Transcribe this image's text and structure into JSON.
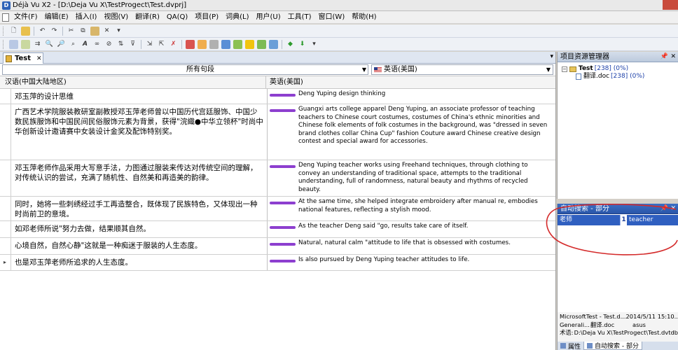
{
  "window": {
    "title": "Déjà Vu X2 - [D:\\Deja Vu X\\TestProgect\\Test.dvprj]"
  },
  "menu": [
    "文件(F)",
    "编辑(E)",
    "插入(I)",
    "视图(V)",
    "翻译(R)",
    "QA(Q)",
    "项目(P)",
    "词典(L)",
    "用户(U)",
    "工具(T)",
    "窗口(W)",
    "帮助(H)"
  ],
  "editor": {
    "tab_label": "Test",
    "filter_value": "所有句段",
    "target_language": "英语(美国)",
    "source_header": "汉语(中国大陆地区)",
    "target_header": "英语(美国)",
    "rows": [
      {
        "src": "邓玉萍的设计思维",
        "tgt": "Deng Yuping design thinking"
      },
      {
        "src": "广西艺术学院服装教研室副教授邓玉萍老师曾以中国历代宫廷服饰、中国少数民族服饰和中国民间民俗服饰元素为背景，获得\"浣織●中华立领杯\"时尚中华创新设计邀请赛中女装设计金奖及配饰特别奖。",
        "tgt": "Guangxi arts college apparel Deng Yuping, an associate professor of teaching teachers to Chinese court costumes, costumes of China's ethnic minorities and Chinese folk elements of folk costumes in the background, was \"dressed in seven brand clothes collar China Cup\" fashion Couture award Chinese creative design contest and special award for accessories."
      },
      {
        "src": "邓玉萍老师作品采用大写意手法，力图通过服装来传达对传统空间的理解，对传统认识的尝试，充满了随机性、自然美和再造美的韵律。",
        "tgt": "Deng Yuping teacher works using Freehand techniques, through clothing to convey an understanding of traditional space, attempts to the traditional understanding, full of randomness, natural beauty and rhythms of recycled beauty."
      },
      {
        "src": "同时，她将一些刺绣经过手工再造整合，既体现了民族特色，又体现出一种时尚前卫的意境。",
        "tgt": "At the same time, she helped integrate embroidery after manual re, embodies national features, reflecting a stylish mood."
      },
      {
        "src": "如邓老师所说\"努力去做，结果顺其自然。",
        "tgt": "As the teacher Deng said \"go, results take care of itself."
      },
      {
        "src": "心境自然，自然心静\"这就是一种痴迷于服装的人生态度。",
        "tgt": "Natural, natural calm \"attitude to life that is obsessed with costumes."
      },
      {
        "src": "也是邓玉萍老师所追求的人生态度。",
        "tgt": "Is also pursued by Deng Yuping teacher attitudes to life."
      }
    ]
  },
  "project_panel": {
    "title": "项目资源管理器",
    "root_label": "Test",
    "root_count": "[238] (0%)",
    "file_label": "翻译.doc",
    "file_count": "[238] (0%)"
  },
  "autosearch_panel": {
    "title": "自动搜索 - 部分",
    "result": {
      "src": "老师",
      "num": "1",
      "tgt": "teacher"
    }
  },
  "properties": [
    [
      "Microsoft",
      "Test - Test.d...",
      "2014/5/11 15:10..."
    ],
    [
      "Generali...",
      "翻译.doc",
      "asus"
    ],
    [
      "术语:",
      "D:\\Deja Vu X\\TestProgect\\Test.dvtdb",
      ""
    ]
  ],
  "bottom_tabs": [
    "属性",
    "自动搜索 - 部分"
  ],
  "colors": {
    "status_bar": "#8d3fcf",
    "annotation": "#d42a2a",
    "selection": "#2f5fc0"
  }
}
